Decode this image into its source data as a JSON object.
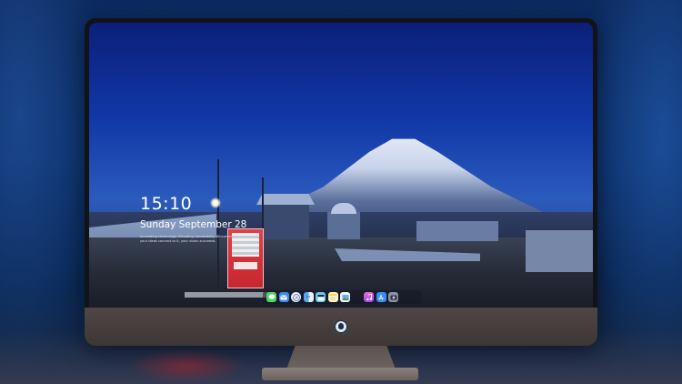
{
  "lockscreen": {
    "time": "15:10",
    "date": "Sunday September 28",
    "caption": "Innovating technology. Elevating connectivity. Wherever your ideas connect to it, your vision succeeds."
  },
  "dock": {
    "items": [
      {
        "name": "messages-icon",
        "color": "#4cd964"
      },
      {
        "name": "mail-icon",
        "color": "#3b8cf0"
      },
      {
        "name": "safari-icon",
        "color": "#e9edf3"
      },
      {
        "name": "finder-icon",
        "color": "#f0c34a"
      },
      {
        "name": "video-icon",
        "color": "#6bc8ee"
      },
      {
        "name": "notes-icon",
        "color": "#f6d65a"
      },
      {
        "name": "photos-icon",
        "color": "#6aa9f0"
      },
      {
        "name": "music-icon",
        "color": "#c65ff2"
      },
      {
        "name": "app-store-icon",
        "color": "#3a8ff7"
      },
      {
        "name": "camera-icon",
        "color": "#8a93a6"
      }
    ]
  },
  "colors": {
    "sky_top": "#0a1f7a",
    "bezel": "#111317",
    "chin": "#4f4745",
    "vending": "#c7252f"
  }
}
